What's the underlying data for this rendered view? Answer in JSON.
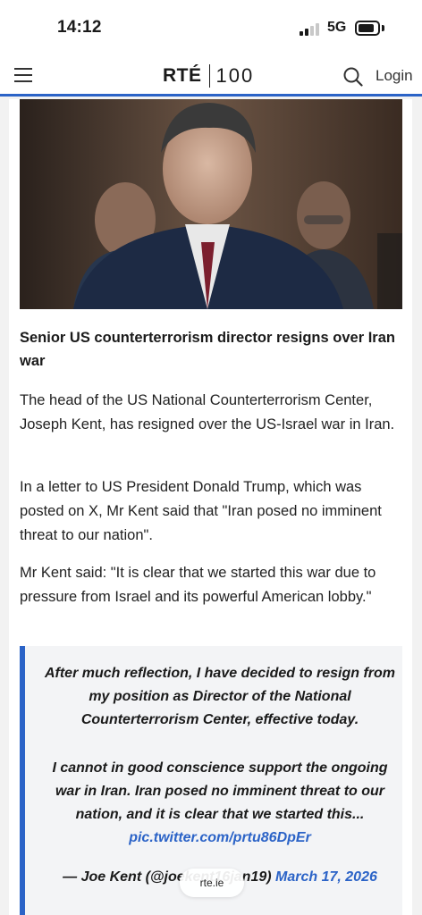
{
  "status_bar": {
    "time": "14:12",
    "network": "5G",
    "battery_level": 0.7
  },
  "header": {
    "logo_main": "RTÉ",
    "logo_suffix": "100",
    "login_label": "Login"
  },
  "article": {
    "headline": "Senior US counterterrorism director resigns over Iran war",
    "paragraphs": [
      "The head of the US National Counterterrorism Center, Joseph Kent, has resigned over the US-Israel war in Iran.",
      "In a letter to US President Donald Trump, which was posted on X, Mr Kent said that \"Iran posed no imminent threat to our nation\".",
      "Mr Kent said: \"It is clear that we started this war due to pressure from Israel and its powerful American lobby.\""
    ],
    "quote": {
      "line1": "After much reflection, I have decided to resign from my position as Director of the National Counterterrorism Center, effective today.",
      "line2": "I cannot in good conscience support the ongoing war in Iran. Iran posed no imminent threat to our nation, and it is clear that we started this... ",
      "link": "pic.twitter.com/prtu86DpEr",
      "attribution": "— Joe Kent (@joekent16jan19) ",
      "date": "March 17, 2026"
    }
  },
  "browser": {
    "url": "rte.ie"
  },
  "colors": {
    "accent": "#2b63c7"
  }
}
